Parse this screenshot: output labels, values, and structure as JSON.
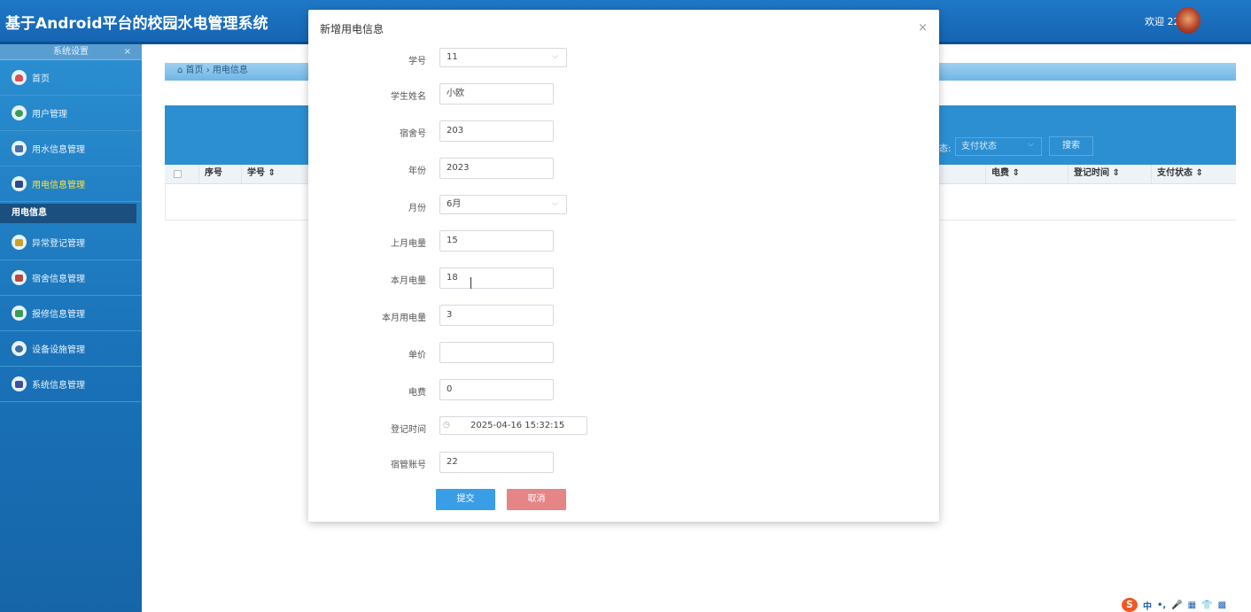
{
  "header": {
    "title": "基于Android平台的校园水电管理系统",
    "welcome": "欢迎 22"
  },
  "sidebar": {
    "title": "系统设置",
    "close_symbol": "×",
    "items": [
      {
        "label": "首页",
        "icon": "home-icon"
      },
      {
        "label": "用户管理",
        "icon": "user-icon"
      },
      {
        "label": "用水信息管理",
        "icon": "water-icon"
      },
      {
        "label": "用电信息管理",
        "icon": "electric-icon"
      },
      {
        "label": "异常登记管理",
        "icon": "warning-icon"
      },
      {
        "label": "宿舍信息管理",
        "icon": "dorm-icon"
      },
      {
        "label": "报修信息管理",
        "icon": "repair-icon"
      },
      {
        "label": "设备设施管理",
        "icon": "device-icon"
      },
      {
        "label": "系统信息管理",
        "icon": "system-icon"
      }
    ],
    "active_sub": "用电信息"
  },
  "breadcrumb": {
    "home": "首页",
    "separator": "›",
    "current": "用电信息"
  },
  "search": {
    "status_label": "态:",
    "status_placeholder": "支付状态",
    "button": "搜索"
  },
  "table": {
    "headers": [
      "序号",
      "学号 ⇕",
      "电费 ⇕",
      "登记时间 ⇕",
      "支付状态 ⇕"
    ]
  },
  "modal": {
    "title": "新增用电信息",
    "close_symbol": "×",
    "fields": {
      "student_id": {
        "label": "学号",
        "value": "11"
      },
      "student_name": {
        "label": "学生姓名",
        "value": "小欧"
      },
      "dorm_no": {
        "label": "宿舍号",
        "value": "203"
      },
      "year": {
        "label": "年份",
        "value": "2023"
      },
      "month": {
        "label": "月份",
        "value": "6月"
      },
      "last_month_reading": {
        "label": "上月电量",
        "value": "15"
      },
      "this_month_reading": {
        "label": "本月电量",
        "value": "18"
      },
      "this_month_usage": {
        "label": "本月用电量",
        "value": "3"
      },
      "unit_price": {
        "label": "单价",
        "value": ""
      },
      "fee": {
        "label": "电费",
        "value": "0"
      },
      "register_time": {
        "label": "登记时间",
        "value": "2025-04-16 15:32:15"
      },
      "manager_account": {
        "label": "宿管账号",
        "value": "22"
      }
    },
    "submit": "提交",
    "cancel": "取消"
  },
  "ime": {
    "logo": "S",
    "items": [
      "中",
      "•,",
      "🎤",
      "▦",
      "👕",
      "▩"
    ]
  },
  "colors": {
    "header": "#1f78c6",
    "sidebar": "#2a8fd1",
    "active_nav": "#ffe23a",
    "submit": "#3a9ee7",
    "cancel": "#e58585"
  }
}
